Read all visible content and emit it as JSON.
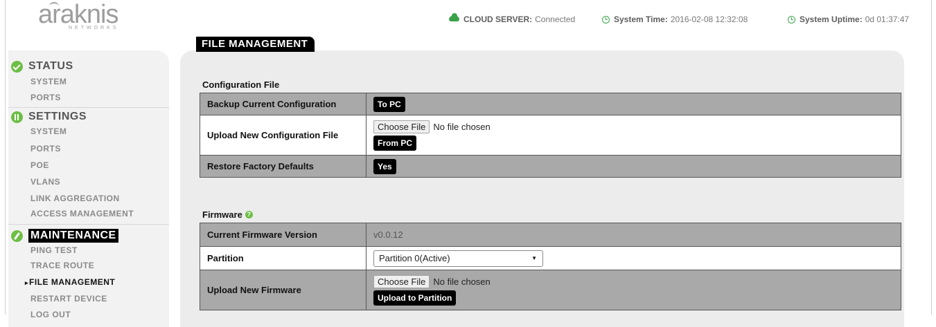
{
  "brand": {
    "name": "araknis",
    "tagline": "NETWORKS"
  },
  "header": {
    "cloud_label": "CLOUD SERVER:",
    "cloud_value": "Connected",
    "time_label": "System Time:",
    "time_value": "2016-02-08 12:32:08",
    "uptime_label": "System Uptime:",
    "uptime_value": "0d 01:37:47",
    "status_color": "#3aa34a"
  },
  "sidebar": {
    "status": {
      "title": "STATUS",
      "items": [
        "SYSTEM",
        "PORTS"
      ]
    },
    "settings": {
      "title": "SETTINGS",
      "items": [
        "SYSTEM",
        "PORTS",
        "POE",
        "VLANS",
        "LINK AGGREGATION",
        "ACCESS MANAGEMENT"
      ]
    },
    "maintenance": {
      "title": "MAINTENANCE",
      "items": [
        "PING TEST",
        "TRACE ROUTE",
        "FILE MANAGEMENT",
        "RESTART DEVICE",
        "LOG OUT"
      ],
      "active": "FILE MANAGEMENT"
    }
  },
  "page": {
    "title": "FILE MANAGEMENT"
  },
  "config": {
    "heading": "Configuration File",
    "backup_label": "Backup Current Configuration",
    "backup_button": "To PC",
    "upload_label": "Upload New Configuration File",
    "choose_button": "Choose File",
    "no_file": "No file chosen",
    "upload_button": "From PC",
    "restore_label": "Restore Factory Defaults",
    "restore_button": "Yes"
  },
  "firmware": {
    "heading": "Firmware",
    "help_icon": "question-icon",
    "version_label": "Current Firmware Version",
    "version_value": "v0.0.12",
    "partition_label": "Partition",
    "partition_selected": "Partition 0(Active)",
    "upload_label": "Upload New Firmware",
    "choose_button": "Choose File",
    "no_file": "No file chosen",
    "upload_button": "Upload to Partition"
  },
  "colors": {
    "accent": "#6dbe45",
    "table_dark": "#a9a9a9",
    "panel": "#ececec"
  }
}
